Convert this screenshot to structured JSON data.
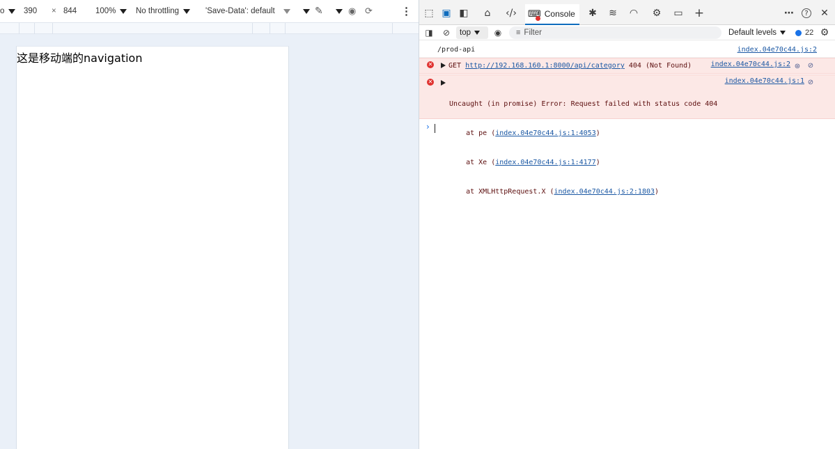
{
  "device_toolbar": {
    "device_select": "o",
    "width": "390",
    "times": "×",
    "height": "844",
    "zoom": "100%",
    "throttling": "No throttling",
    "save_data": "'Save-Data': default",
    "more": "⋮"
  },
  "viewport": {
    "nav_text": "这是移动端的navigation"
  },
  "devtools_tabs": {
    "console_label": "Console",
    "more": "⋯",
    "help": "?",
    "close": "✕"
  },
  "console_toolbar": {
    "context": "top",
    "filter_placeholder": "Filter",
    "levels": "Default levels",
    "issues_count": "22"
  },
  "console": {
    "log": {
      "text": "/prod-api",
      "source": "index.04e70c44.js:2"
    },
    "get_error": {
      "method": "GET ",
      "url": "http://192.168.160.1:8000/api/category",
      "status": " 404 (Not Found)",
      "source": "index.04e70c44.js:2"
    },
    "uncaught_error": {
      "line1": "Uncaught (in promise) Error: Request failed with status code 404",
      "source": "index.04e70c44.js:1",
      "stack": [
        {
          "prefix": "    at pe (",
          "link": "index.04e70c44.js:1:4053",
          "suffix": ")"
        },
        {
          "prefix": "    at Xe (",
          "link": "index.04e70c44.js:1:4177",
          "suffix": ")"
        },
        {
          "prefix": "    at XMLHttpRequest.X (",
          "link": "index.04e70c44.js:2:1803",
          "suffix": ")"
        }
      ]
    },
    "prompt": "›"
  }
}
